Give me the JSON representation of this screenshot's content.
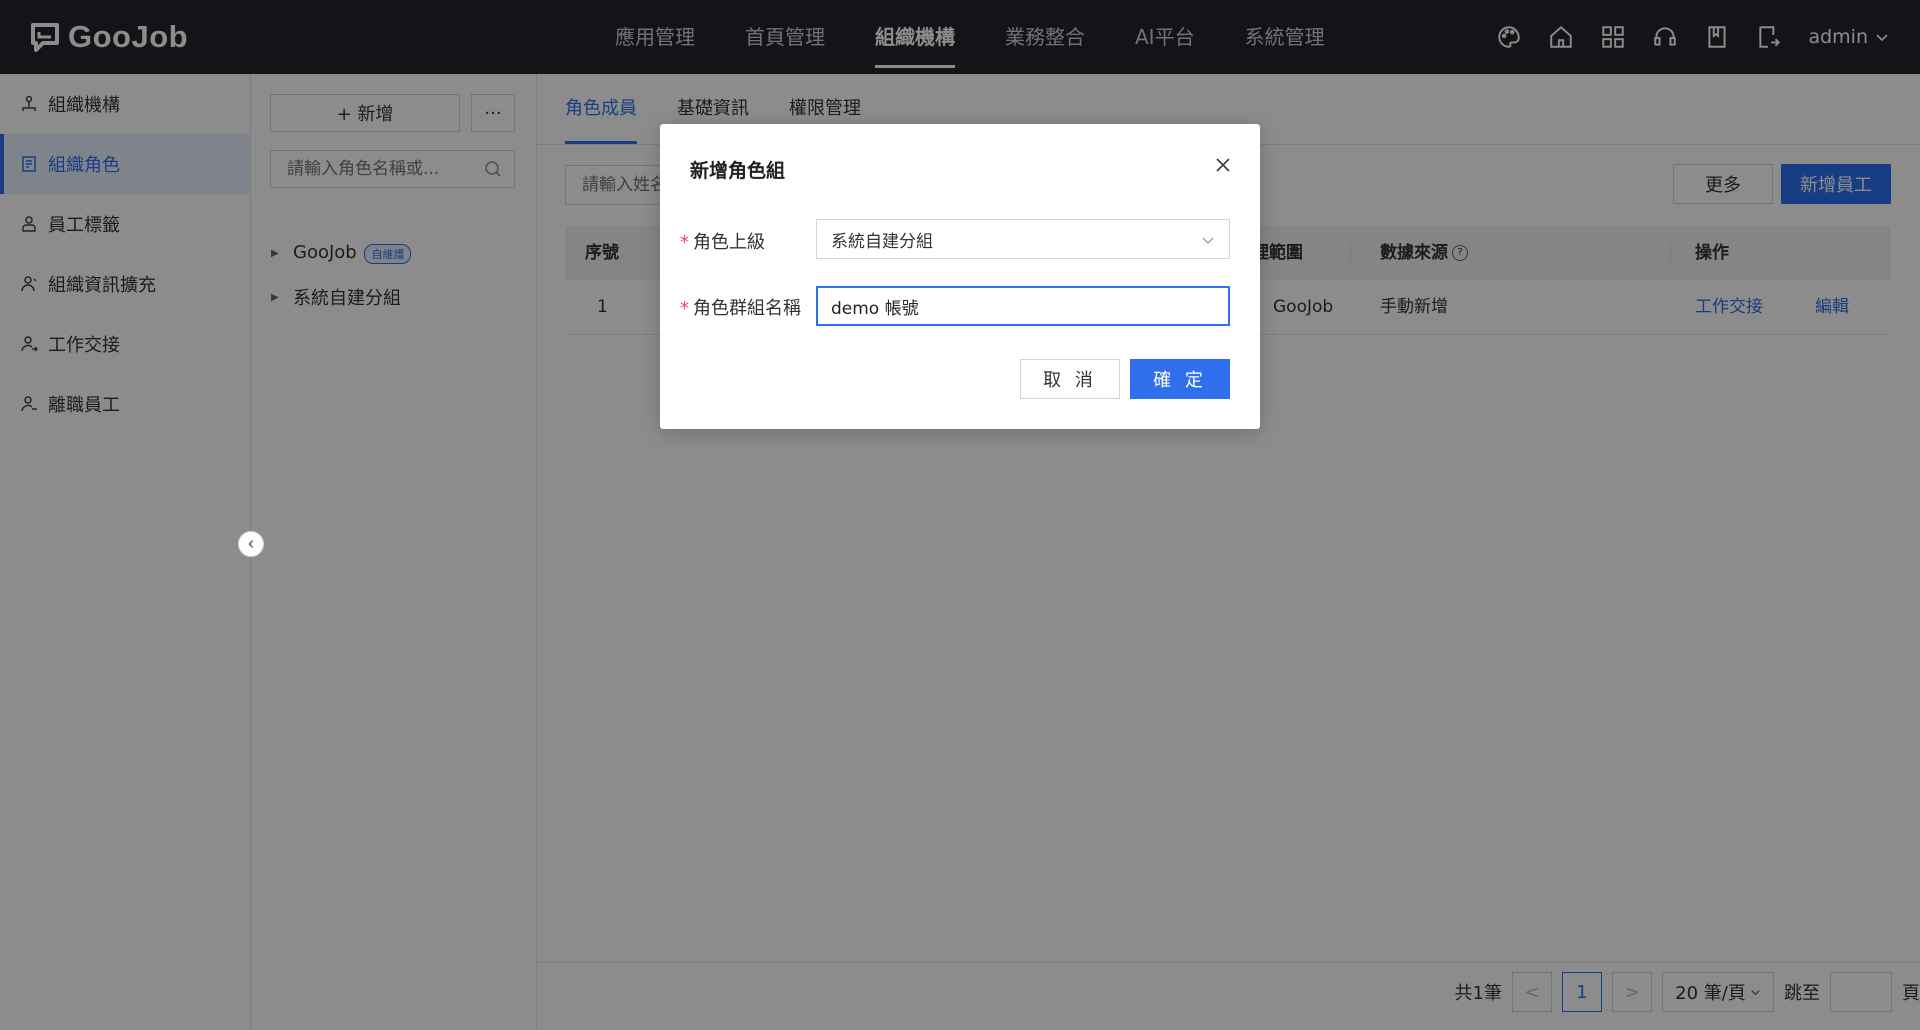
{
  "brand": {
    "name": "GooJob"
  },
  "topnav": {
    "items": [
      {
        "label": "應用管理"
      },
      {
        "label": "首頁管理"
      },
      {
        "label": "組織機構",
        "active": true
      },
      {
        "label": "業務整合"
      },
      {
        "label": "AI平台"
      },
      {
        "label": "系統管理"
      }
    ],
    "icons": [
      "palette-icon",
      "home-icon",
      "apps-grid-icon",
      "support-icon",
      "book-icon",
      "export-icon"
    ],
    "user": "admin"
  },
  "sidebar": {
    "items": [
      {
        "label": "組織機構",
        "icon": "org-icon"
      },
      {
        "label": "組織角色",
        "icon": "role-icon",
        "active": true
      },
      {
        "label": "員工標籤",
        "icon": "tag-icon"
      },
      {
        "label": "組織資訊擴充",
        "icon": "user-extend-icon"
      },
      {
        "label": "工作交接",
        "icon": "handover-icon"
      },
      {
        "label": "離職員工",
        "icon": "resigned-icon"
      }
    ]
  },
  "tree": {
    "add_label": "+ 新增",
    "more_label": "···",
    "search_placeholder": "請輸入角色名稱或...",
    "nodes": [
      {
        "label": "GooJob",
        "badge": "自維護"
      },
      {
        "label": "系統自建分組"
      }
    ]
  },
  "main": {
    "tabs": [
      {
        "label": "角色成員",
        "active": true
      },
      {
        "label": "基礎資訊"
      },
      {
        "label": "權限管理"
      }
    ],
    "search_placeholder": "請輸入姓名",
    "more_button": "更多",
    "new_button": "新增員工",
    "table": {
      "headers": {
        "index": "序號",
        "scope": "理範圍",
        "source": "數據來源",
        "actions": "操作"
      },
      "rows": [
        {
          "index": "1",
          "scope": "GooJob",
          "source": "手動新增",
          "action1": "工作交接",
          "action2": "編輯"
        }
      ]
    },
    "pager": {
      "total": "共1筆",
      "prev": "<",
      "current": "1",
      "next": ">",
      "page_size": "20 筆/頁",
      "jump_label": "跳至",
      "page_suffix": "頁"
    }
  },
  "modal": {
    "title": "新增角色組",
    "parent_label": "角色上級",
    "parent_value": "系統自建分組",
    "name_label": "角色群組名稱",
    "name_value": "demo 帳號",
    "cancel": "取 消",
    "confirm": "確 定"
  },
  "colors": {
    "accent": "#2f6fed",
    "topbar": "#24262b",
    "required": "#e34d59"
  }
}
